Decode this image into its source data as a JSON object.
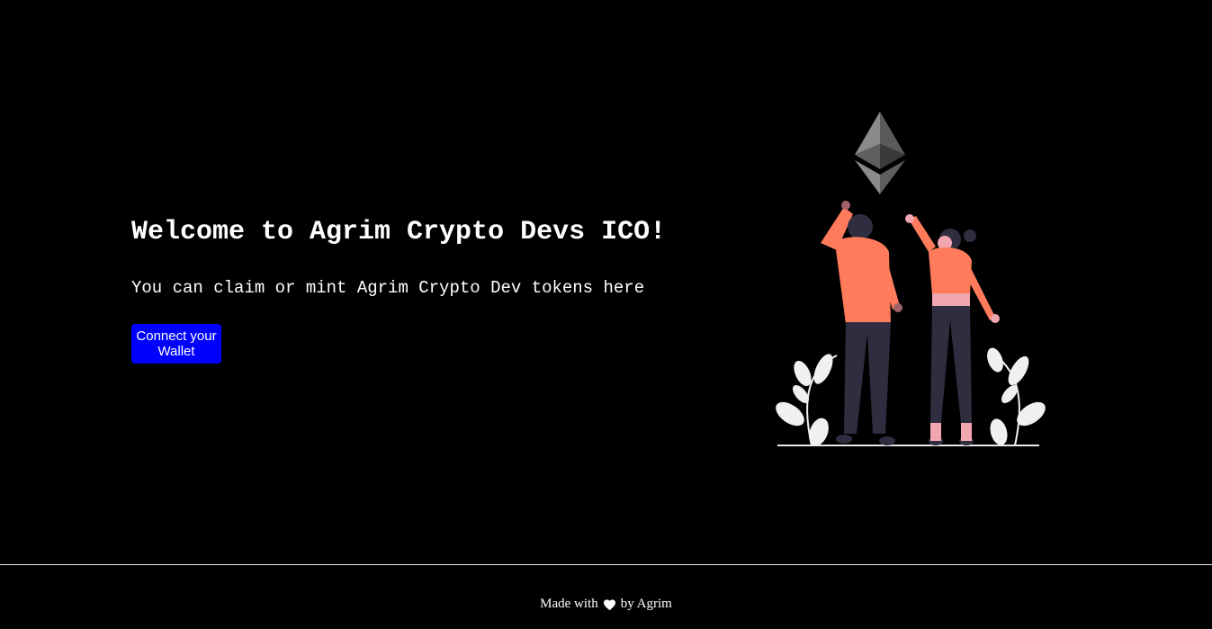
{
  "main": {
    "title": "Welcome to Agrim Crypto Devs ICO!",
    "description": "You can claim or mint Agrim Crypto Dev tokens here",
    "connect_button_label": "Connect your Wallet",
    "connect_button_color": "#0000ff"
  },
  "illustration": {
    "logo_icon": "ethereum-icon",
    "people": "two-people-cheering",
    "accent_color": "#ff7b5c"
  },
  "footer": {
    "made_with": "Made with",
    "heart_icon": "heart-icon",
    "by": "by Agrim"
  }
}
